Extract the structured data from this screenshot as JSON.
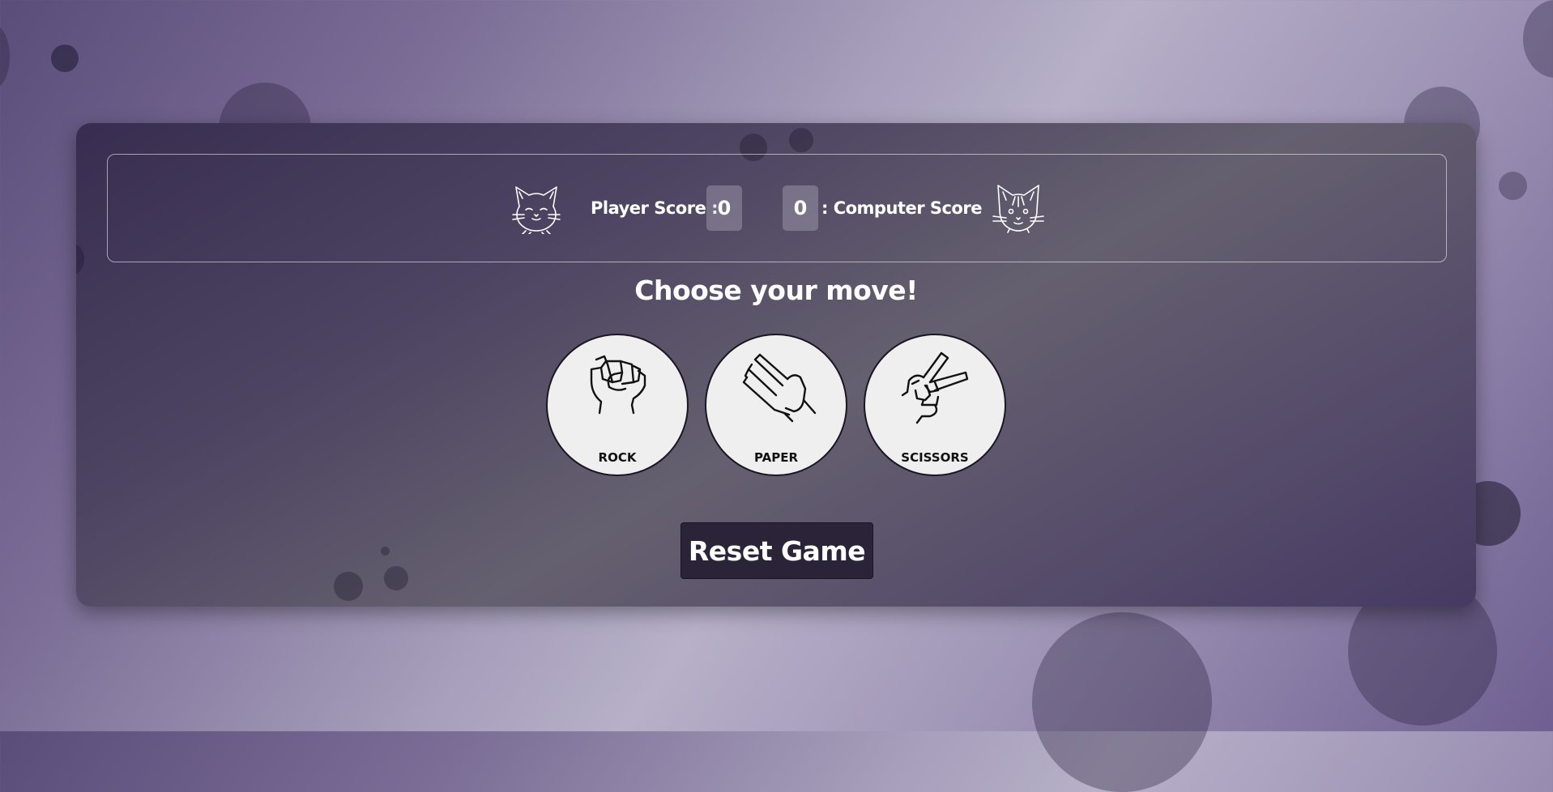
{
  "scoreboard": {
    "player_label": "Player Score :",
    "player_score": "0",
    "computer_score": "0",
    "computer_label": ": Computer Score",
    "player_avatar_icon": "cat-face-icon",
    "computer_avatar_icon": "cat-face-icon"
  },
  "prompt": "Choose your move!",
  "moves": [
    {
      "label": "ROCK",
      "icon": "fist-icon"
    },
    {
      "label": "PAPER",
      "icon": "open-hand-icon"
    },
    {
      "label": "SCISSORS",
      "icon": "peace-hand-icon"
    }
  ],
  "reset_label": "Reset Game",
  "colors": {
    "card": "#4d4462",
    "score_box": "#8b8598",
    "move_circle": "#efefef",
    "reset_button": "#2b2438",
    "text": "#ffffff"
  }
}
